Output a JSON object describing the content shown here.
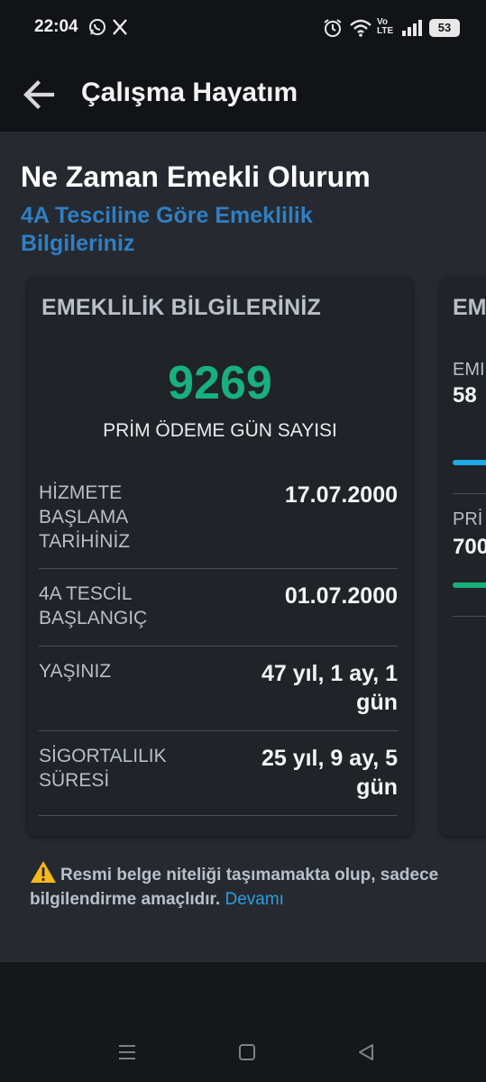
{
  "status_bar": {
    "time": "22:04",
    "battery": "53",
    "network_label": "Vo LTE",
    "icons": [
      "whatsapp-icon",
      "x-icon",
      "alarm-icon",
      "wifi-icon",
      "volte-icon",
      "signal-icon",
      "battery-icon"
    ]
  },
  "app_bar": {
    "title": "Çalışma Hayatım",
    "back_icon": "arrow-left-icon"
  },
  "page": {
    "heading": "Ne Zaman Emekli Olurum",
    "subheading": "4A Tesciline Göre Emeklilik Bilgileriniz"
  },
  "card_main": {
    "title": "EMEKLİLİK BİLGİLERİNİZ",
    "prim_days": "9269",
    "prim_label": "PRİM ÖDEME GÜN SAYISI",
    "rows": [
      {
        "label": "HİZMETE BAŞLAMA TARİHİNİZ",
        "value": "17.07.2000"
      },
      {
        "label": "4A TESCİL BAŞLANGIÇ",
        "value": "01.07.2000"
      },
      {
        "label": "YAŞINIZ",
        "value": "47 yıl, 1 ay, 1 gün"
      },
      {
        "label": "SİGORTALILIK SÜRESİ",
        "value": "25 yıl, 9 ay, 5 gün"
      }
    ]
  },
  "card_next": {
    "title": "EM",
    "label_1": "EMI",
    "value_1": "58",
    "label_2": "PRİ",
    "value_2": "700"
  },
  "notice": {
    "icon": "warning-icon",
    "text": "Resmi belge niteliği taşımamakta olup, sadece bilgilendirme amaçlıdır.",
    "link": "Devamı"
  },
  "colors": {
    "accent_green": "#18b07c",
    "accent_blue": "#2f7fc4",
    "link_blue": "#2b9fe0",
    "bar_blue": "#1da8e6",
    "bar_green": "#18b07c",
    "warning": "#f6b81a"
  },
  "nav_bar": {
    "icons": [
      "menu-icon",
      "home-square-icon",
      "back-triangle-icon"
    ]
  }
}
